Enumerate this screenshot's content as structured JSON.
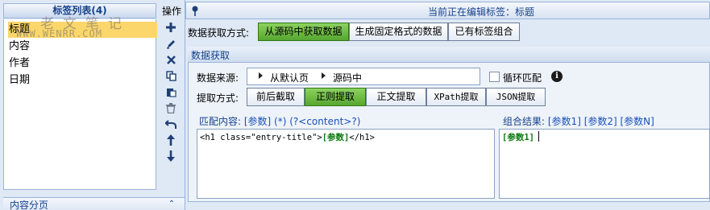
{
  "left_panel": {
    "header": "标签列表(4)",
    "items": [
      {
        "label": "标题",
        "selected": true
      },
      {
        "label": "内容",
        "selected": false
      },
      {
        "label": "作者",
        "selected": false
      },
      {
        "label": "日期",
        "selected": false
      }
    ],
    "watermark_cn": "老文笔记",
    "watermark_en": "WWW.WENRR.COM",
    "pager_label": "内容分页",
    "pager_toggle_icon": "double-chevron-up-icon"
  },
  "toolbar": {
    "title": "操作",
    "tools": [
      "add-icon",
      "edit-icon",
      "delete-icon",
      "copy-icon",
      "paste-icon",
      "trash-icon",
      "undo-icon",
      "move-up-icon",
      "move-down-icon"
    ]
  },
  "editor": {
    "editing_label": "当前正在编辑标签：标题",
    "mode_label": "数据获取方式:",
    "modes": [
      {
        "label": "从源码中获取数据",
        "active": true
      },
      {
        "label": "生成固定格式的数据",
        "active": false
      },
      {
        "label": "已有标签组合",
        "active": false
      }
    ],
    "extract_title": "数据获取",
    "source_label": "数据来源:",
    "source_crumbs": [
      "从默认页",
      "源码中"
    ],
    "loop_label": "循环匹配",
    "loop_checked": false,
    "info_icon": "i",
    "method_label": "提取方式:",
    "methods": [
      {
        "label": "前后截取",
        "active": false
      },
      {
        "label": "正则提取",
        "active": true
      },
      {
        "label": "正文提取",
        "active": false
      },
      {
        "label": "XPath提取",
        "active": false
      },
      {
        "label": "JSON提取",
        "active": false
      }
    ],
    "match_label": "匹配内容:",
    "match_hint": "[参数]  (*)  (?<content>?)",
    "match_value_prefix": "<h1 class=\"entry-title\">",
    "match_value_param": "[参数]",
    "match_value_suffix": "</h1>",
    "result_label": "组合结果:",
    "result_hint": "[参数1]  [参数2]  [参数N]",
    "result_value": "[参数1]"
  },
  "colors": {
    "active_green": "#56a630",
    "selected_row": "#fbd66a",
    "panel_bg": "#dfe8f5",
    "title_blue": "#15428b"
  }
}
